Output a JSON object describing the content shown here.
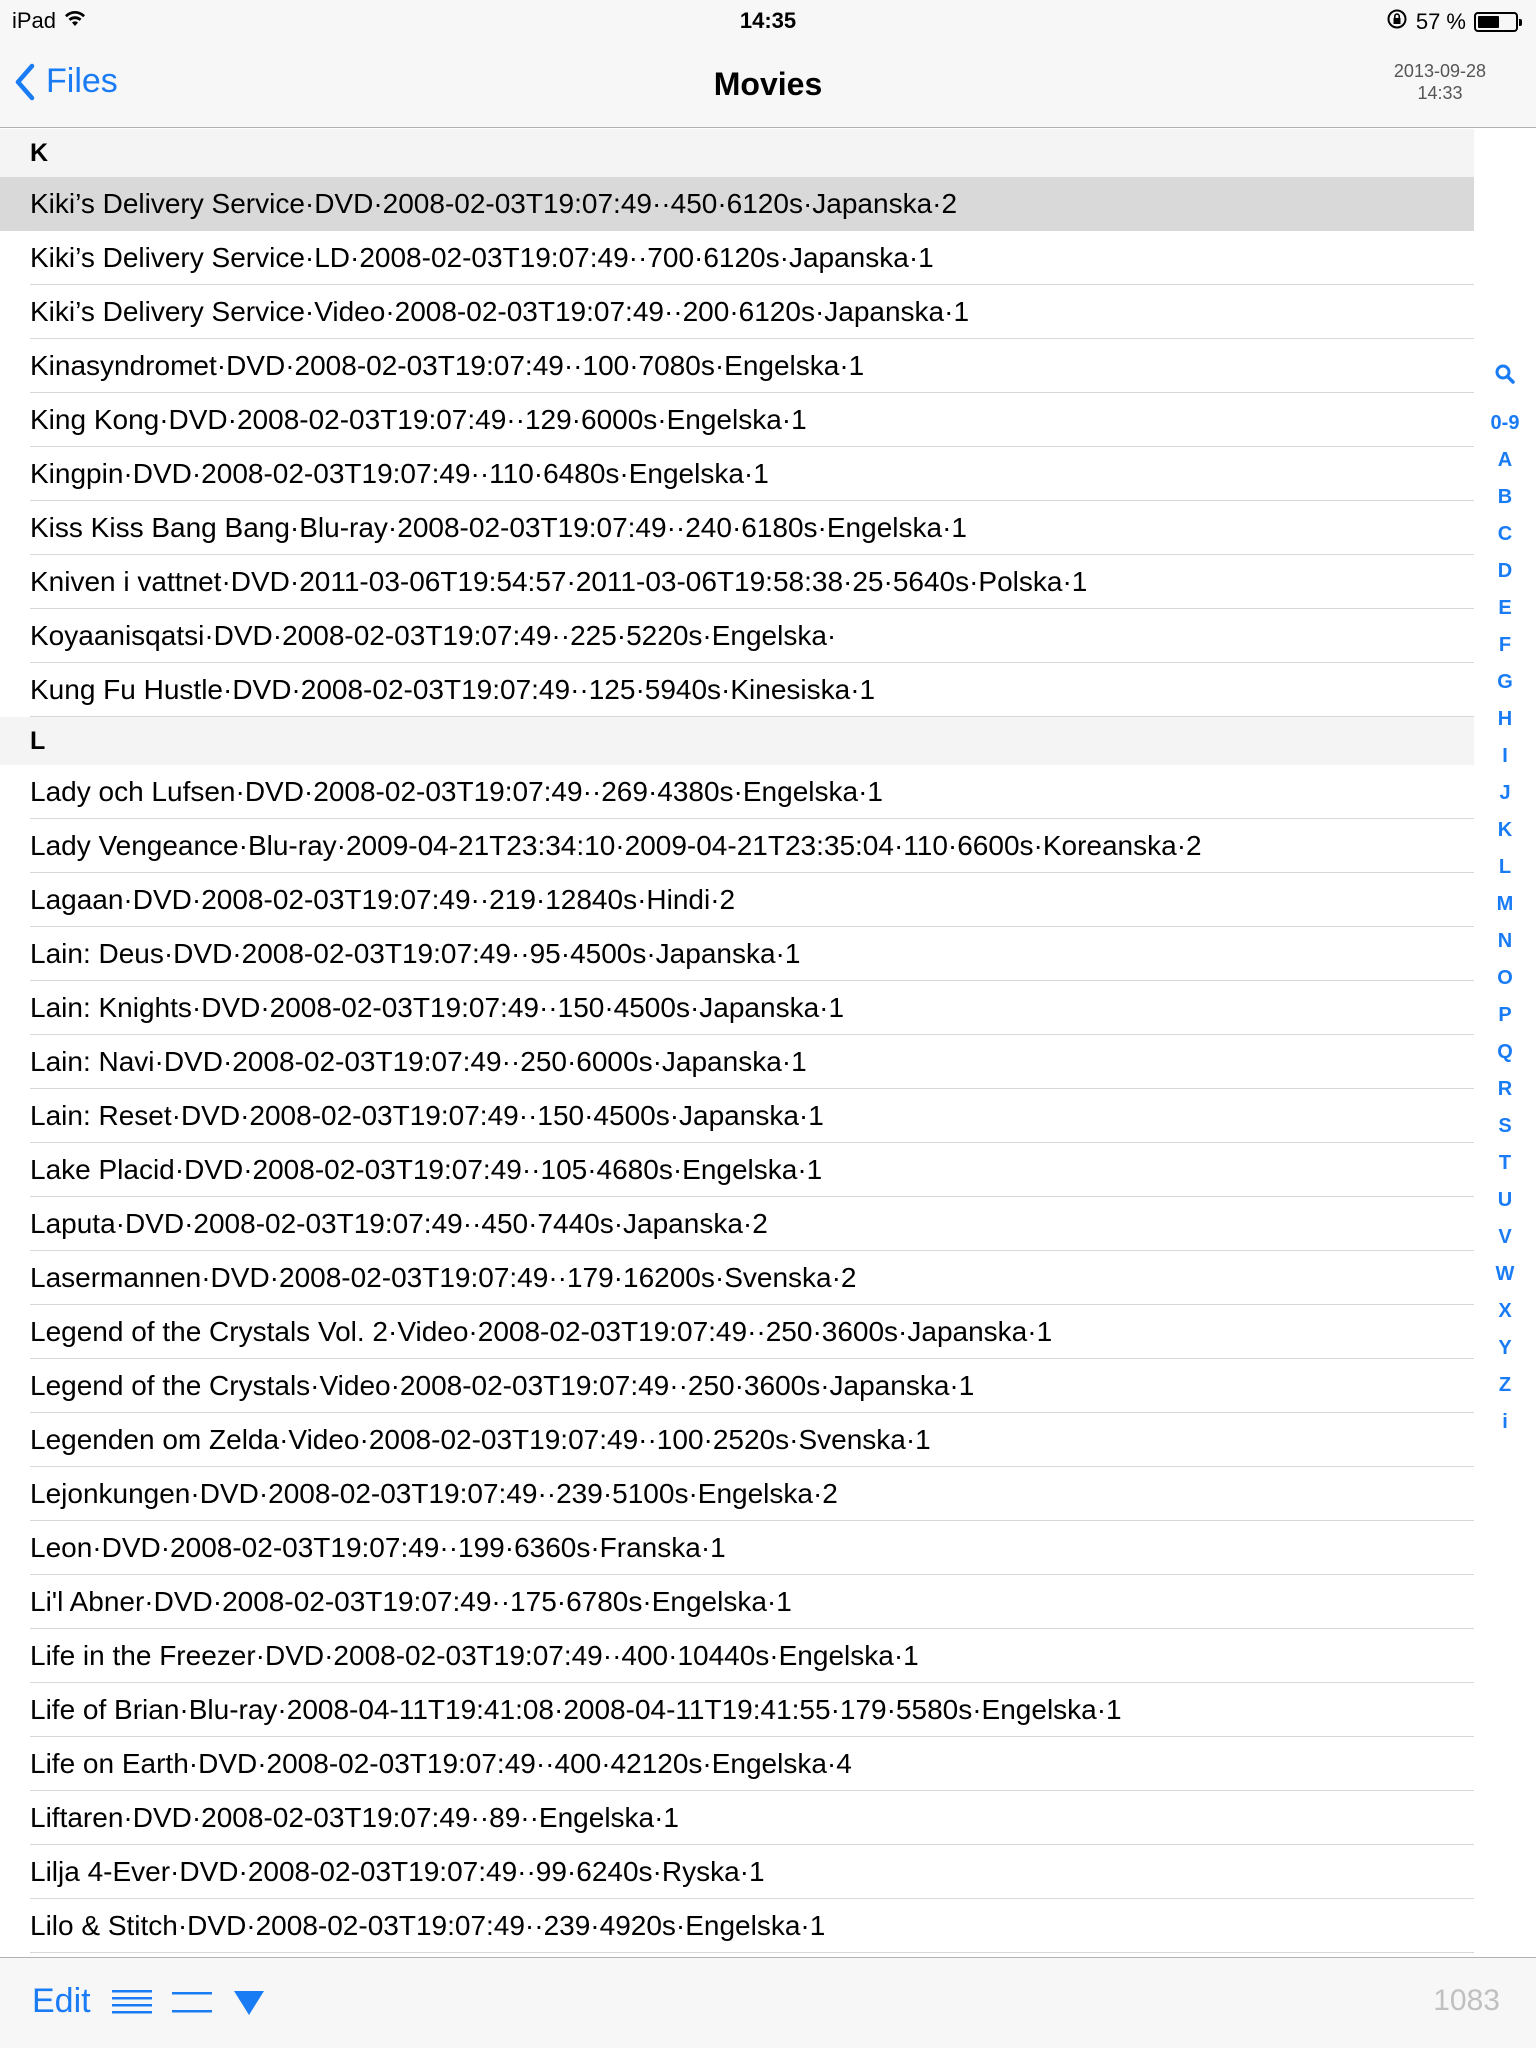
{
  "status_bar": {
    "device": "iPad",
    "time": "14:35",
    "battery": "57 %",
    "battery_level": 0.57
  },
  "nav": {
    "back_label": "Files",
    "title": "Movies",
    "date": "2013-09-28",
    "time": "14:33"
  },
  "sections": [
    {
      "header": "K",
      "rows": [
        "Kiki’s Delivery Service·DVD·2008-02-03T19:07:49··450·6120s·Japanska·2",
        "Kiki’s Delivery Service·LD·2008-02-03T19:07:49··700·6120s·Japanska·1",
        "Kiki’s Delivery Service·Video·2008-02-03T19:07:49··200·6120s·Japanska·1",
        "Kinasyndromet·DVD·2008-02-03T19:07:49··100·7080s·Engelska·1",
        "King Kong·DVD·2008-02-03T19:07:49··129·6000s·Engelska·1",
        "Kingpin·DVD·2008-02-03T19:07:49··110·6480s·Engelska·1",
        "Kiss Kiss Bang Bang·Blu-ray·2008-02-03T19:07:49··240·6180s·Engelska·1",
        "Kniven i vattnet·DVD·2011-03-06T19:54:57·2011-03-06T19:58:38·25·5640s·Polska·1",
        "Koyaanisqatsi·DVD·2008-02-03T19:07:49··225·5220s·Engelska·",
        "Kung Fu Hustle·DVD·2008-02-03T19:07:49··125·5940s·Kinesiska·1"
      ]
    },
    {
      "header": "L",
      "rows": [
        "Lady och Lufsen·DVD·2008-02-03T19:07:49··269·4380s·Engelska·1",
        "Lady Vengeance·Blu-ray·2009-04-21T23:34:10·2009-04-21T23:35:04·110·6600s·Koreanska·2",
        "Lagaan·DVD·2008-02-03T19:07:49··219·12840s·Hindi·2",
        "Lain: Deus·DVD·2008-02-03T19:07:49··95·4500s·Japanska·1",
        "Lain: Knights·DVD·2008-02-03T19:07:49··150·4500s·Japanska·1",
        "Lain: Navi·DVD·2008-02-03T19:07:49··250·6000s·Japanska·1",
        "Lain: Reset·DVD·2008-02-03T19:07:49··150·4500s·Japanska·1",
        "Lake Placid·DVD·2008-02-03T19:07:49··105·4680s·Engelska·1",
        "Laputa·DVD·2008-02-03T19:07:49··450·7440s·Japanska·2",
        "Lasermannen·DVD·2008-02-03T19:07:49··179·16200s·Svenska·2",
        "Legend of the Crystals Vol. 2·Video·2008-02-03T19:07:49··250·3600s·Japanska·1",
        "Legend of the Crystals·Video·2008-02-03T19:07:49··250·3600s·Japanska·1",
        "Legenden om Zelda·Video·2008-02-03T19:07:49··100·2520s·Svenska·1",
        "Lejonkungen·DVD·2008-02-03T19:07:49··239·5100s·Engelska·2",
        "Leon·DVD·2008-02-03T19:07:49··199·6360s·Franska·1",
        "Li'l Abner·DVD·2008-02-03T19:07:49··175·6780s·Engelska·1",
        "Life in the Freezer·DVD·2008-02-03T19:07:49··400·10440s·Engelska·1",
        "Life of Brian·Blu-ray·2008-04-11T19:41:08·2008-04-11T19:41:55·179·5580s·Engelska·1",
        "Life on Earth·DVD·2008-02-03T19:07:49··400·42120s·Engelska·4",
        "Liftaren·DVD·2008-02-03T19:07:49··89··Engelska·1",
        "Lilja 4-Ever·DVD·2008-02-03T19:07:49··99·6240s·Ryska·1",
        "Lilo & Stitch·DVD·2008-02-03T19:07:49··239·4920s·Engelska·1"
      ]
    }
  ],
  "index": [
    "0-9",
    "A",
    "B",
    "C",
    "D",
    "E",
    "F",
    "G",
    "H",
    "I",
    "J",
    "K",
    "L",
    "M",
    "N",
    "O",
    "P",
    "Q",
    "R",
    "S",
    "T",
    "U",
    "V",
    "W",
    "X",
    "Y",
    "Z",
    "i"
  ],
  "toolbar": {
    "edit_label": "Edit",
    "count": "1083"
  },
  "colors": {
    "accent": "#1a7cf5",
    "selected_row": "#d9d9d9",
    "section_bg": "#f4f4f4",
    "bar_bg": "#f7f7f7"
  }
}
